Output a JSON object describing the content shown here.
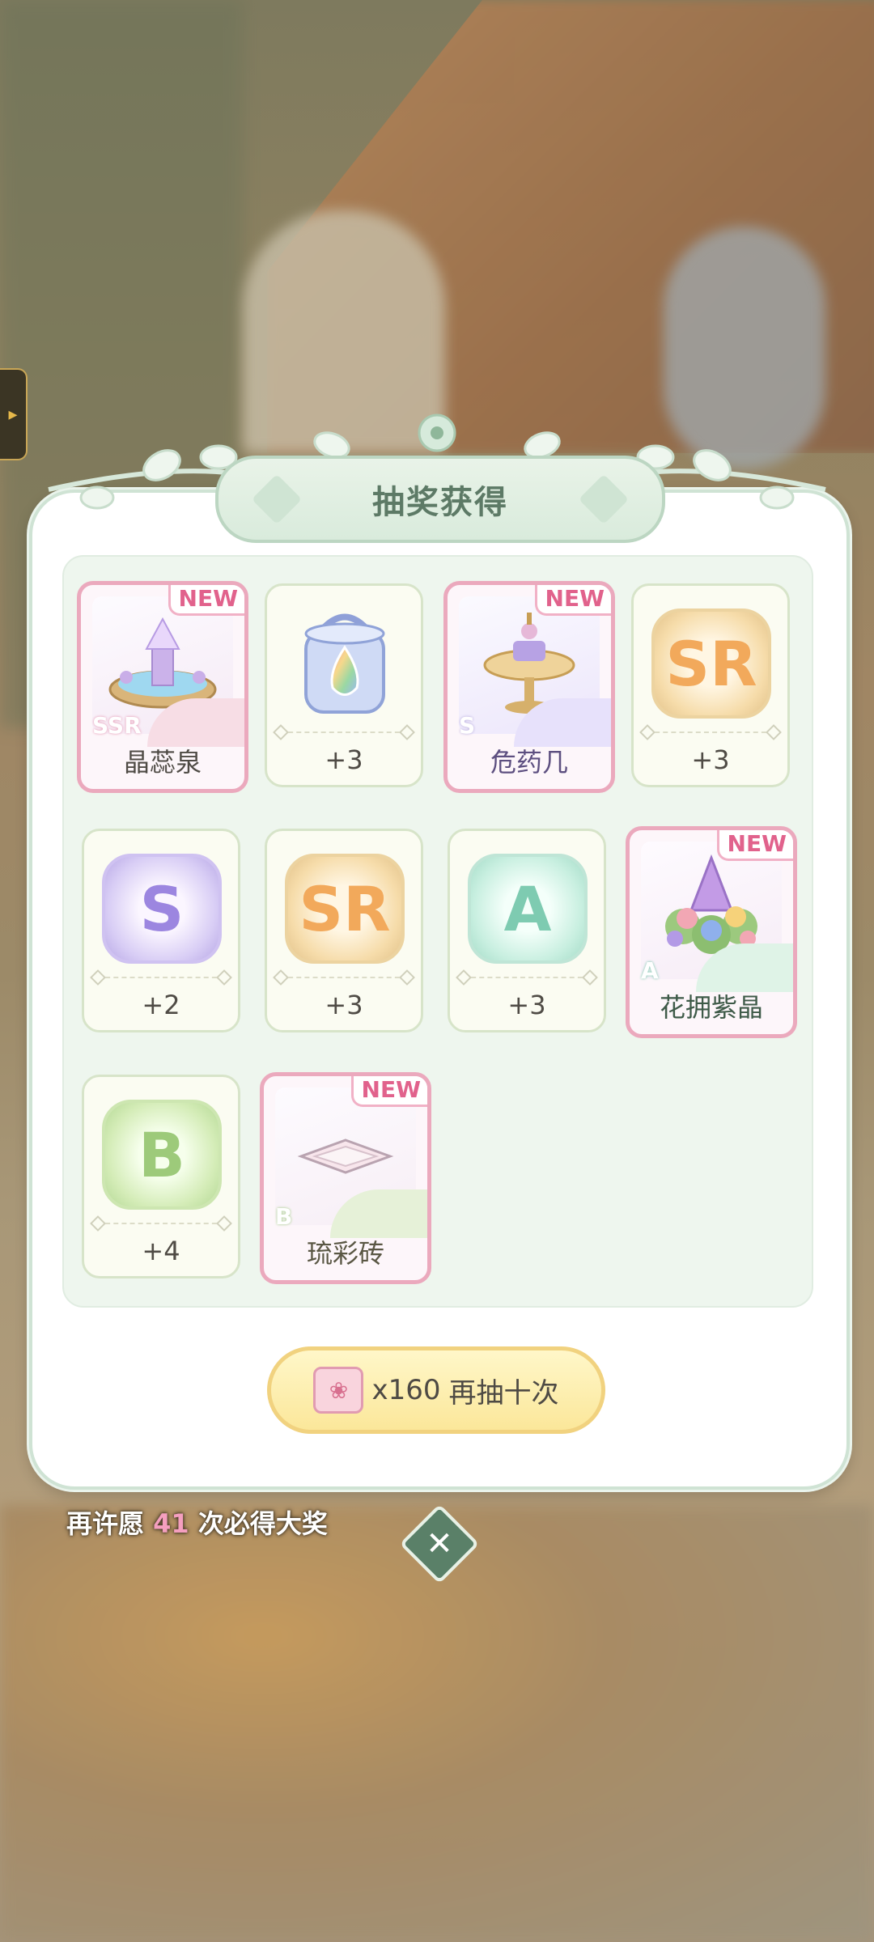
{
  "title": "抽奖获得",
  "new_tag": "NEW",
  "items": [
    {
      "label": "晶蕊泉",
      "rarity": "SSR",
      "icon": "crystal-fountain-icon"
    },
    {
      "label": "+3",
      "icon": "rainbow-dye-jar-icon"
    },
    {
      "label": "危药几",
      "rarity": "S",
      "icon": "potion-table-icon"
    },
    {
      "label": "+3",
      "badge": "SR"
    },
    {
      "label": "+2",
      "badge": "S"
    },
    {
      "label": "+3",
      "badge": "SR"
    },
    {
      "label": "+3",
      "badge": "A"
    },
    {
      "label": "花拥紫晶",
      "rarity": "A",
      "icon": "flower-crystal-icon"
    },
    {
      "label": "+4",
      "badge": "B"
    },
    {
      "label": "琉彩砖",
      "rarity": "B",
      "icon": "glazed-tile-icon"
    }
  ],
  "retry_button": {
    "cost": "x160",
    "label": "再抽十次"
  },
  "pity": {
    "prefix": "再许愿",
    "count": "41",
    "suffix": "次必得大奖"
  },
  "side_tab": "▸",
  "close": "✕"
}
